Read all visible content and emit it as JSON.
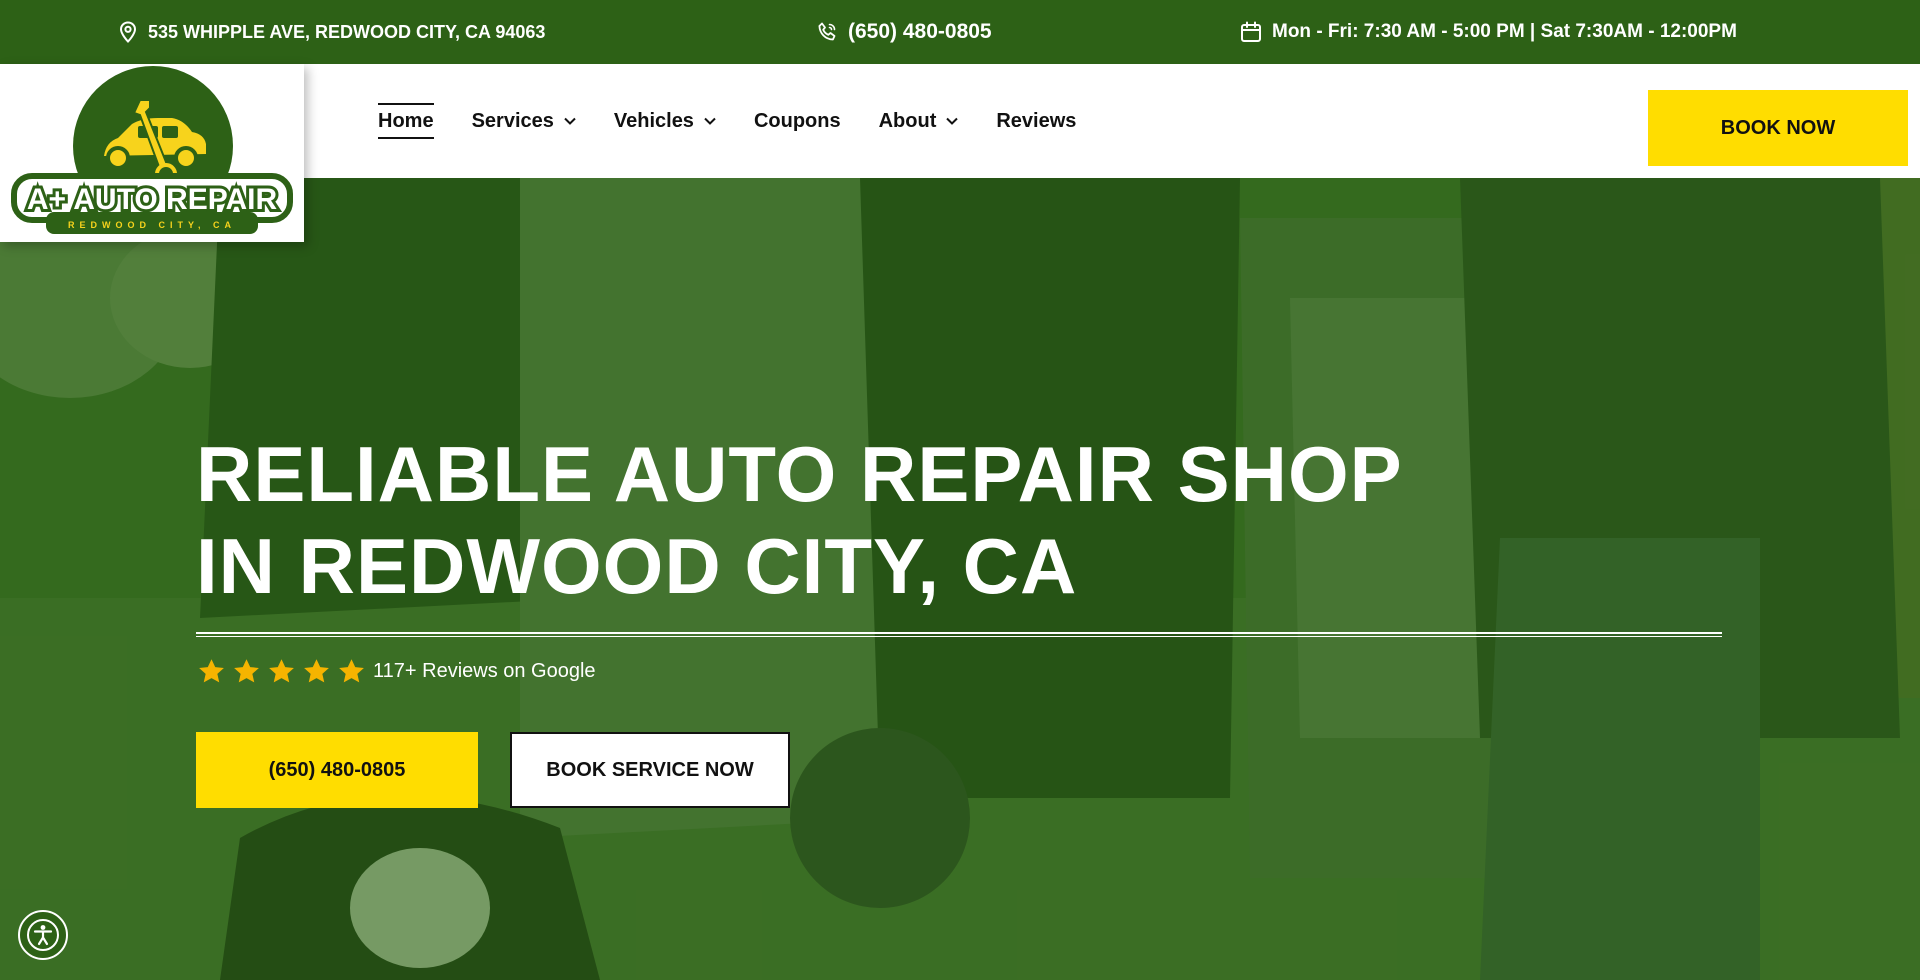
{
  "topbar": {
    "address": "535 WHIPPLE AVE, REDWOOD CITY, CA 94063",
    "phone": "(650) 480-0805",
    "hours": "Mon - Fri: 7:30 AM - 5:00 PM | Sat 7:30AM - 12:00PM"
  },
  "logo": {
    "name": "A+ AUTO REPAIR",
    "tagline": "REDWOOD CITY, CA"
  },
  "nav": {
    "home": "Home",
    "services": "Services",
    "vehicles": "Vehicles",
    "coupons": "Coupons",
    "about": "About",
    "reviews": "Reviews",
    "book_now": "BOOK NOW"
  },
  "hero": {
    "title_line1": "RELIABLE AUTO REPAIR SHOP",
    "title_line2": "IN REDWOOD CITY, CA",
    "rating_stars": 5,
    "reviews_text": "117+ Reviews on Google",
    "phone_button": "(650) 480-0805",
    "book_button": "BOOK SERVICE NOW"
  },
  "colors": {
    "brand_green": "#2d6116",
    "accent_yellow": "#ffdd00",
    "star_color": "#f5b400"
  },
  "icons": {
    "address": "map-pin-icon",
    "phone": "phone-icon",
    "hours": "calendar-icon",
    "dropdown": "chevron-down-icon",
    "rating": "star-icon",
    "accessibility": "accessibility-icon"
  }
}
